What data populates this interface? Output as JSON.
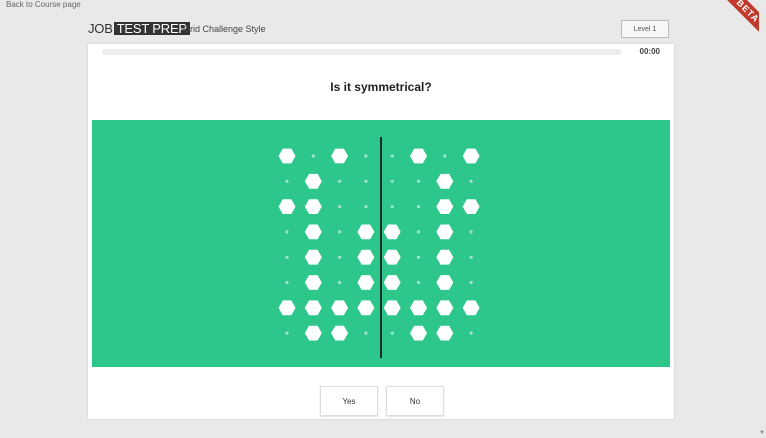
{
  "back_link": "Back to Course page",
  "beta_label": "BETA",
  "logo": {
    "part1": "JOB",
    "part2": "TEST PREP"
  },
  "page_style_title": "Grid Challenge Style",
  "level_button": "Level 1",
  "timer": "00:00",
  "progress": 0,
  "question": "Is it symmetrical?",
  "colors": {
    "panel": "#2ec78b",
    "divider": "#1f2d27",
    "shape": "#ffffff",
    "ribbon": "#c0392b"
  },
  "grid": {
    "cols": 8,
    "rows": 8,
    "cells": [
      [
        1,
        0,
        1,
        0,
        0,
        1,
        0,
        1
      ],
      [
        0,
        1,
        0,
        0,
        0,
        0,
        1,
        0
      ],
      [
        1,
        1,
        0,
        0,
        0,
        0,
        1,
        1
      ],
      [
        0,
        1,
        0,
        1,
        1,
        0,
        1,
        0
      ],
      [
        0,
        1,
        0,
        1,
        1,
        0,
        1,
        0
      ],
      [
        0,
        1,
        0,
        1,
        1,
        0,
        1,
        0
      ],
      [
        1,
        1,
        1,
        1,
        1,
        1,
        1,
        1
      ],
      [
        0,
        1,
        1,
        0,
        0,
        1,
        1,
        0
      ]
    ]
  },
  "answers": {
    "yes": "Yes",
    "no": "No"
  }
}
